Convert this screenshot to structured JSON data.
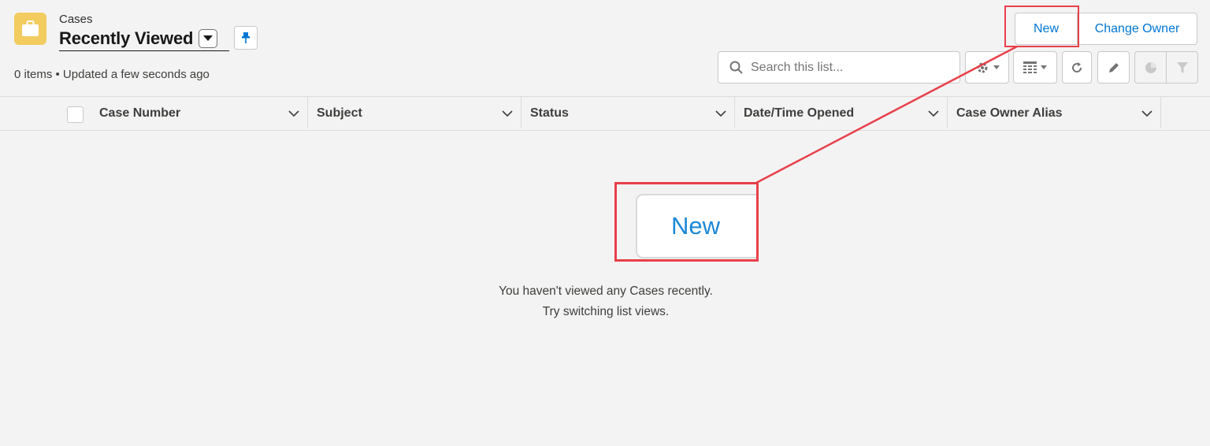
{
  "header": {
    "object_label": "Cases",
    "list_view_title": "Recently Viewed",
    "meta": "0 items • Updated a few seconds ago",
    "object_icon": "briefcase-icon",
    "object_icon_color": "#f2cc5f"
  },
  "actions": {
    "new_label": "New",
    "change_owner_label": "Change Owner"
  },
  "search": {
    "placeholder": "Search this list..."
  },
  "toolbar": {
    "buttons": [
      "gear-icon",
      "table-icon",
      "refresh-icon",
      "pencil-icon",
      "pie-chart-icon",
      "filter-icon"
    ]
  },
  "table": {
    "columns": [
      "Case Number",
      "Subject",
      "Status",
      "Date/Time Opened",
      "Case Owner Alias"
    ]
  },
  "empty_state": {
    "line1": "You haven't viewed any Cases recently.",
    "line2": "Try switching list views."
  },
  "callout": {
    "zoom_label": "New",
    "color": "#e8404a"
  },
  "colors": {
    "brand_blue": "#0176d3",
    "background": "#f3f3f3"
  }
}
